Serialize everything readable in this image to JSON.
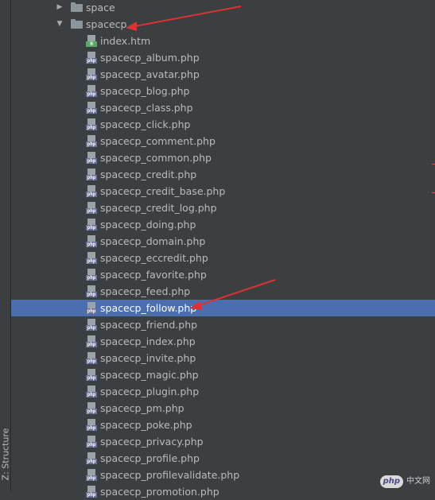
{
  "panel": {
    "tab_label": "Z: Structure"
  },
  "folders": [
    {
      "name": "space",
      "expanded": false
    },
    {
      "name": "spacecp",
      "expanded": true
    }
  ],
  "files": [
    {
      "name": "index.htm",
      "type": "htm",
      "badge": "H"
    },
    {
      "name": "spacecp_album.php",
      "type": "php",
      "badge": "php"
    },
    {
      "name": "spacecp_avatar.php",
      "type": "php",
      "badge": "php"
    },
    {
      "name": "spacecp_blog.php",
      "type": "php",
      "badge": "php"
    },
    {
      "name": "spacecp_class.php",
      "type": "php",
      "badge": "php"
    },
    {
      "name": "spacecp_click.php",
      "type": "php",
      "badge": "php"
    },
    {
      "name": "spacecp_comment.php",
      "type": "php",
      "badge": "php"
    },
    {
      "name": "spacecp_common.php",
      "type": "php",
      "badge": "php"
    },
    {
      "name": "spacecp_credit.php",
      "type": "php",
      "badge": "php"
    },
    {
      "name": "spacecp_credit_base.php",
      "type": "php",
      "badge": "php"
    },
    {
      "name": "spacecp_credit_log.php",
      "type": "php",
      "badge": "php"
    },
    {
      "name": "spacecp_doing.php",
      "type": "php",
      "badge": "php"
    },
    {
      "name": "spacecp_domain.php",
      "type": "php",
      "badge": "php"
    },
    {
      "name": "spacecp_eccredit.php",
      "type": "php",
      "badge": "php"
    },
    {
      "name": "spacecp_favorite.php",
      "type": "php",
      "badge": "php"
    },
    {
      "name": "spacecp_feed.php",
      "type": "php",
      "badge": "php"
    },
    {
      "name": "spacecp_follow.php",
      "type": "php",
      "badge": "php",
      "selected": true
    },
    {
      "name": "spacecp_friend.php",
      "type": "php",
      "badge": "php"
    },
    {
      "name": "spacecp_index.php",
      "type": "php",
      "badge": "php"
    },
    {
      "name": "spacecp_invite.php",
      "type": "php",
      "badge": "php"
    },
    {
      "name": "spacecp_magic.php",
      "type": "php",
      "badge": "php"
    },
    {
      "name": "spacecp_plugin.php",
      "type": "php",
      "badge": "php"
    },
    {
      "name": "spacecp_pm.php",
      "type": "php",
      "badge": "php"
    },
    {
      "name": "spacecp_poke.php",
      "type": "php",
      "badge": "php"
    },
    {
      "name": "spacecp_privacy.php",
      "type": "php",
      "badge": "php"
    },
    {
      "name": "spacecp_profile.php",
      "type": "php",
      "badge": "php"
    },
    {
      "name": "spacecp_profilevalidate.php",
      "type": "php",
      "badge": "php"
    },
    {
      "name": "spacecp_promotion.php",
      "type": "php",
      "badge": "php"
    }
  ],
  "watermark": {
    "logo": "php",
    "text": "中文网"
  },
  "colors": {
    "background": "#3c3f41",
    "selection": "#4b6eaf",
    "annotation": "#e03030",
    "php_badge": "#6a6f9a",
    "htm_badge": "#59a869",
    "folder": "#8c9599"
  }
}
